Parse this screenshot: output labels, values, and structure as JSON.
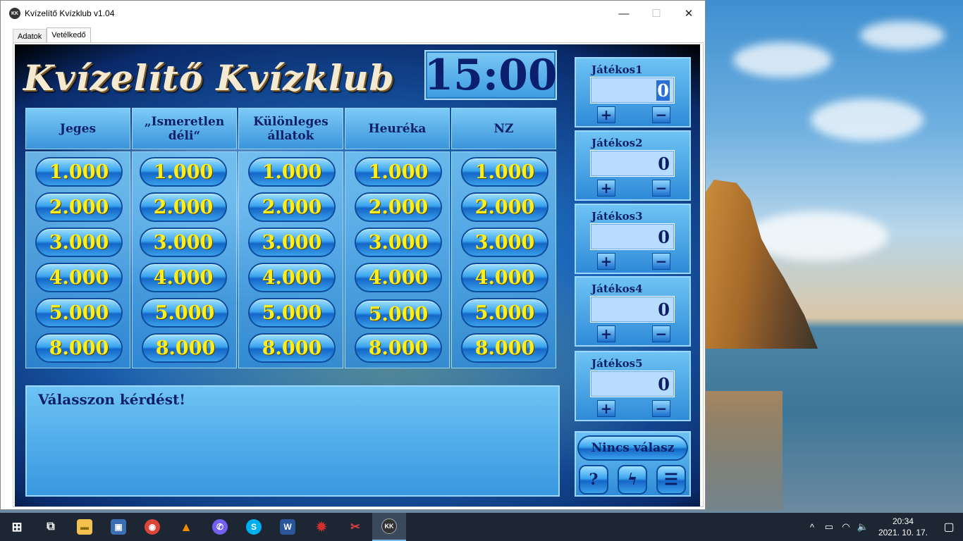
{
  "window": {
    "title": "Kvízelítő Kvízklub v1.04",
    "icon_text": "KK",
    "controls": {
      "minimize": "—",
      "maximize": "☐",
      "close": "✕"
    }
  },
  "tabs": [
    {
      "label": "Adatok"
    },
    {
      "label": "Vetélkedő"
    }
  ],
  "game": {
    "title": "Kvízelítő Kvízklub",
    "timer": "15:00",
    "columns": [
      {
        "header": "Jeges",
        "values": [
          "1.000",
          "2.000",
          "3.000",
          "4.000",
          "5.000",
          "8.000"
        ]
      },
      {
        "header": "„Ismeretlen déli“",
        "values": [
          "1.000",
          "2.000",
          "3.000",
          "4.000",
          "5.000",
          "8.000"
        ]
      },
      {
        "header": "Különleges állatok",
        "values": [
          "1.000",
          "2.000",
          "3.000",
          "4.000",
          "5.000",
          "8.000"
        ]
      },
      {
        "header": "Heuréka",
        "values": [
          "1.000",
          "2.000",
          "3.000",
          "4.000",
          "5.000",
          "8.000"
        ]
      },
      {
        "header": "NZ",
        "values": [
          "1.000",
          "2.000",
          "3.000",
          "4.000",
          "5.000",
          "8.000"
        ]
      }
    ],
    "question_text": "Válasszon kérdést!",
    "players": [
      {
        "name": "Játékos1",
        "score": "0"
      },
      {
        "name": "Játékos2",
        "score": "0"
      },
      {
        "name": "Játékos3",
        "score": "0"
      },
      {
        "name": "Játékos4",
        "score": "0"
      },
      {
        "name": "Játékos5",
        "score": "0"
      }
    ],
    "plus_label": "+",
    "minus_label": "−",
    "no_answer_label": "Nincs válasz",
    "tool_buttons": {
      "help": "?",
      "flash": "ϟ",
      "list": "☰"
    }
  },
  "taskbar": {
    "apps": [
      {
        "name": "start-icon",
        "glyph": "⊞",
        "color": "#1c2733"
      },
      {
        "name": "task-view-icon",
        "glyph": "⧉",
        "color": "#1c2733"
      },
      {
        "name": "file-explorer-icon",
        "glyph": "▬",
        "color": "#f2c14e"
      },
      {
        "name": "save-disk-icon",
        "glyph": "▣",
        "color": "#3b6fb5"
      },
      {
        "name": "chrome-icon",
        "glyph": "◉",
        "color": "#db4437"
      },
      {
        "name": "vlc-icon",
        "glyph": "▲",
        "color": "#f08a00"
      },
      {
        "name": "viber-icon",
        "glyph": "✆",
        "color": "#7360f2"
      },
      {
        "name": "skype-icon",
        "glyph": "S",
        "color": "#00aff0"
      },
      {
        "name": "word-icon",
        "glyph": "W",
        "color": "#2b579a"
      },
      {
        "name": "game-app-icon",
        "glyph": "✹",
        "color": "#b02020"
      },
      {
        "name": "snipping-tool-icon",
        "glyph": "✂",
        "color": "#c0392b"
      },
      {
        "name": "kvizklub-app-icon",
        "glyph": "KK",
        "color": "#333333"
      }
    ],
    "tray": {
      "chevron": "^",
      "battery": "▭",
      "wifi": "◠",
      "volume": "🔈",
      "notification_center": "▢",
      "time": "20:34",
      "date": "2021. 10. 17."
    }
  }
}
